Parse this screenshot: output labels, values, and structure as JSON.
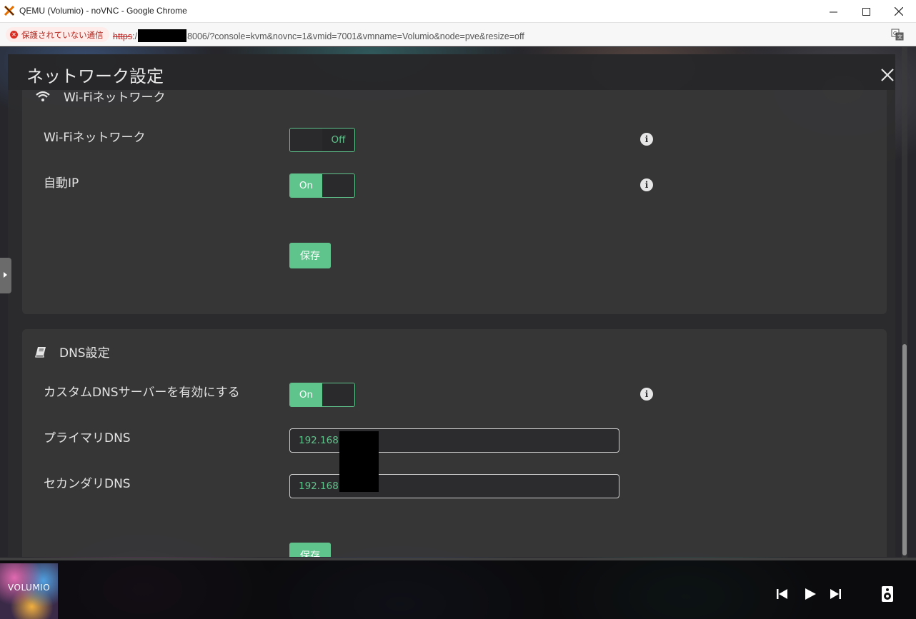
{
  "browser": {
    "window_title": "QEMU (Volumio) - noVNC - Google Chrome",
    "security_label": "保護されていない通信",
    "url_scheme": "https",
    "url_sep": ":/",
    "url_rest": "8006/?console=kvm&novnc=1&vmid=7001&vmname=Volumio&node=pve&resize=off"
  },
  "modal": {
    "title": "ネットワーク設定"
  },
  "wifi_section": {
    "heading": "Wi-Fiネットワーク",
    "rows": [
      {
        "label": "Wi-Fiネットワーク",
        "toggle_text": "Off",
        "state": "off"
      },
      {
        "label": "自動IP",
        "toggle_text": "On",
        "state": "on"
      }
    ],
    "save_label": "保存"
  },
  "dns_section": {
    "heading": "DNS設定",
    "custom_dns": {
      "label": "カスタムDNSサーバーを有効にする",
      "toggle_text": "On",
      "state": "on"
    },
    "primary": {
      "label": "プライマリDNS",
      "value": "192.168."
    },
    "secondary": {
      "label": "セカンダリDNS",
      "value": "192.168."
    },
    "save_label": "保存"
  },
  "player": {
    "cover_text": "VOLUMIO"
  },
  "colors": {
    "accent": "#5fc48b",
    "insecure": "#d93025"
  }
}
